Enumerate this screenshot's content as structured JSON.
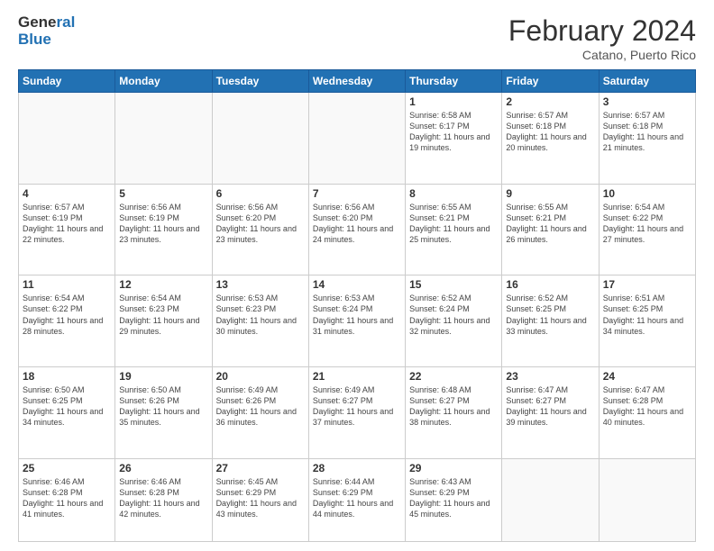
{
  "header": {
    "logo_general": "General",
    "logo_blue": "Blue",
    "month_title": "February 2024",
    "subtitle": "Catano, Puerto Rico"
  },
  "weekdays": [
    "Sunday",
    "Monday",
    "Tuesday",
    "Wednesday",
    "Thursday",
    "Friday",
    "Saturday"
  ],
  "weeks": [
    [
      {
        "day": "",
        "info": ""
      },
      {
        "day": "",
        "info": ""
      },
      {
        "day": "",
        "info": ""
      },
      {
        "day": "",
        "info": ""
      },
      {
        "day": "1",
        "info": "Sunrise: 6:58 AM\nSunset: 6:17 PM\nDaylight: 11 hours and 19 minutes."
      },
      {
        "day": "2",
        "info": "Sunrise: 6:57 AM\nSunset: 6:18 PM\nDaylight: 11 hours and 20 minutes."
      },
      {
        "day": "3",
        "info": "Sunrise: 6:57 AM\nSunset: 6:18 PM\nDaylight: 11 hours and 21 minutes."
      }
    ],
    [
      {
        "day": "4",
        "info": "Sunrise: 6:57 AM\nSunset: 6:19 PM\nDaylight: 11 hours and 22 minutes."
      },
      {
        "day": "5",
        "info": "Sunrise: 6:56 AM\nSunset: 6:19 PM\nDaylight: 11 hours and 23 minutes."
      },
      {
        "day": "6",
        "info": "Sunrise: 6:56 AM\nSunset: 6:20 PM\nDaylight: 11 hours and 23 minutes."
      },
      {
        "day": "7",
        "info": "Sunrise: 6:56 AM\nSunset: 6:20 PM\nDaylight: 11 hours and 24 minutes."
      },
      {
        "day": "8",
        "info": "Sunrise: 6:55 AM\nSunset: 6:21 PM\nDaylight: 11 hours and 25 minutes."
      },
      {
        "day": "9",
        "info": "Sunrise: 6:55 AM\nSunset: 6:21 PM\nDaylight: 11 hours and 26 minutes."
      },
      {
        "day": "10",
        "info": "Sunrise: 6:54 AM\nSunset: 6:22 PM\nDaylight: 11 hours and 27 minutes."
      }
    ],
    [
      {
        "day": "11",
        "info": "Sunrise: 6:54 AM\nSunset: 6:22 PM\nDaylight: 11 hours and 28 minutes."
      },
      {
        "day": "12",
        "info": "Sunrise: 6:54 AM\nSunset: 6:23 PM\nDaylight: 11 hours and 29 minutes."
      },
      {
        "day": "13",
        "info": "Sunrise: 6:53 AM\nSunset: 6:23 PM\nDaylight: 11 hours and 30 minutes."
      },
      {
        "day": "14",
        "info": "Sunrise: 6:53 AM\nSunset: 6:24 PM\nDaylight: 11 hours and 31 minutes."
      },
      {
        "day": "15",
        "info": "Sunrise: 6:52 AM\nSunset: 6:24 PM\nDaylight: 11 hours and 32 minutes."
      },
      {
        "day": "16",
        "info": "Sunrise: 6:52 AM\nSunset: 6:25 PM\nDaylight: 11 hours and 33 minutes."
      },
      {
        "day": "17",
        "info": "Sunrise: 6:51 AM\nSunset: 6:25 PM\nDaylight: 11 hours and 34 minutes."
      }
    ],
    [
      {
        "day": "18",
        "info": "Sunrise: 6:50 AM\nSunset: 6:25 PM\nDaylight: 11 hours and 34 minutes."
      },
      {
        "day": "19",
        "info": "Sunrise: 6:50 AM\nSunset: 6:26 PM\nDaylight: 11 hours and 35 minutes."
      },
      {
        "day": "20",
        "info": "Sunrise: 6:49 AM\nSunset: 6:26 PM\nDaylight: 11 hours and 36 minutes."
      },
      {
        "day": "21",
        "info": "Sunrise: 6:49 AM\nSunset: 6:27 PM\nDaylight: 11 hours and 37 minutes."
      },
      {
        "day": "22",
        "info": "Sunrise: 6:48 AM\nSunset: 6:27 PM\nDaylight: 11 hours and 38 minutes."
      },
      {
        "day": "23",
        "info": "Sunrise: 6:47 AM\nSunset: 6:27 PM\nDaylight: 11 hours and 39 minutes."
      },
      {
        "day": "24",
        "info": "Sunrise: 6:47 AM\nSunset: 6:28 PM\nDaylight: 11 hours and 40 minutes."
      }
    ],
    [
      {
        "day": "25",
        "info": "Sunrise: 6:46 AM\nSunset: 6:28 PM\nDaylight: 11 hours and 41 minutes."
      },
      {
        "day": "26",
        "info": "Sunrise: 6:46 AM\nSunset: 6:28 PM\nDaylight: 11 hours and 42 minutes."
      },
      {
        "day": "27",
        "info": "Sunrise: 6:45 AM\nSunset: 6:29 PM\nDaylight: 11 hours and 43 minutes."
      },
      {
        "day": "28",
        "info": "Sunrise: 6:44 AM\nSunset: 6:29 PM\nDaylight: 11 hours and 44 minutes."
      },
      {
        "day": "29",
        "info": "Sunrise: 6:43 AM\nSunset: 6:29 PM\nDaylight: 11 hours and 45 minutes."
      },
      {
        "day": "",
        "info": ""
      },
      {
        "day": "",
        "info": ""
      }
    ]
  ]
}
